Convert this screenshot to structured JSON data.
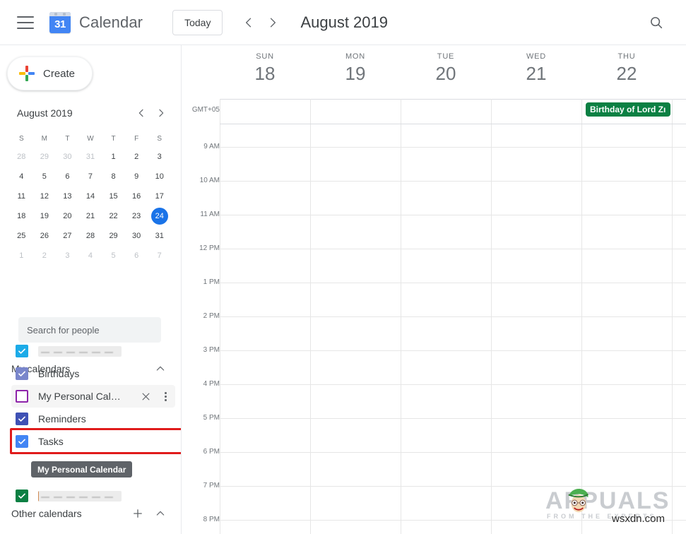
{
  "topbar": {
    "menu_icon": "hamburger-icon",
    "logo_day": "31",
    "app_title": "Calendar",
    "today_label": "Today",
    "prev_icon": "chevron-left-icon",
    "next_icon": "chevron-right-icon",
    "month_title": "August 2019",
    "search_icon": "search-icon"
  },
  "sidebar": {
    "create_label": "Create",
    "create_icon": "plus-icon",
    "mini_calendar": {
      "month_title": "August 2019",
      "prev_icon": "chevron-left-icon",
      "next_icon": "chevron-right-icon",
      "dow": [
        "S",
        "M",
        "T",
        "W",
        "T",
        "F",
        "S"
      ],
      "weeks": [
        [
          {
            "d": "28",
            "muted": true
          },
          {
            "d": "29",
            "muted": true
          },
          {
            "d": "30",
            "muted": true
          },
          {
            "d": "31",
            "muted": true
          },
          {
            "d": "1"
          },
          {
            "d": "2"
          },
          {
            "d": "3"
          }
        ],
        [
          {
            "d": "4"
          },
          {
            "d": "5"
          },
          {
            "d": "6"
          },
          {
            "d": "7"
          },
          {
            "d": "8"
          },
          {
            "d": "9"
          },
          {
            "d": "10"
          }
        ],
        [
          {
            "d": "11"
          },
          {
            "d": "12"
          },
          {
            "d": "13"
          },
          {
            "d": "14"
          },
          {
            "d": "15"
          },
          {
            "d": "16"
          },
          {
            "d": "17"
          }
        ],
        [
          {
            "d": "18"
          },
          {
            "d": "19"
          },
          {
            "d": "20"
          },
          {
            "d": "21"
          },
          {
            "d": "22"
          },
          {
            "d": "23"
          },
          {
            "d": "24",
            "today": true
          }
        ],
        [
          {
            "d": "25"
          },
          {
            "d": "26"
          },
          {
            "d": "27"
          },
          {
            "d": "28"
          },
          {
            "d": "29"
          },
          {
            "d": "30"
          },
          {
            "d": "31"
          }
        ],
        [
          {
            "d": "1",
            "muted": true
          },
          {
            "d": "2",
            "muted": true
          },
          {
            "d": "3",
            "muted": true
          },
          {
            "d": "4",
            "muted": true
          },
          {
            "d": "5",
            "muted": true
          },
          {
            "d": "6",
            "muted": true
          },
          {
            "d": "7",
            "muted": true
          }
        ]
      ]
    },
    "search_people_placeholder": "Search for people",
    "my_calendars": {
      "title": "My calendars",
      "collapse_icon": "chevron-up-icon",
      "items": [
        {
          "label": "",
          "redacted": true,
          "checked": true,
          "color": "#1cabe8"
        },
        {
          "label": "Birthdays",
          "redacted": false,
          "checked": true,
          "color": "#7986cb"
        },
        {
          "label": "My Personal Cal…",
          "redacted": false,
          "checked": false,
          "color": "#8e24aa",
          "hovered": true,
          "close_icon": "close-icon",
          "options_icon": "more-options-icon"
        },
        {
          "label": "Reminders",
          "redacted": false,
          "checked": true,
          "color": "#3f51b5"
        },
        {
          "label": "Tasks",
          "redacted": false,
          "checked": true,
          "color": "#4285f4"
        }
      ]
    },
    "other_calendars": {
      "title": "Other calendars",
      "add_icon": "plus-icon",
      "collapse_icon": "chevron-up-icon",
      "items": [
        {
          "label": "",
          "redacted": true,
          "checked": true,
          "color": "#0b8043"
        }
      ]
    },
    "tooltip_text": "My Personal Calendar"
  },
  "grid": {
    "timezone": "GMT+05",
    "days": [
      {
        "dow": "SUN",
        "num": "18"
      },
      {
        "dow": "MON",
        "num": "19"
      },
      {
        "dow": "TUE",
        "num": "20"
      },
      {
        "dow": "WED",
        "num": "21"
      },
      {
        "dow": "THU",
        "num": "22"
      }
    ],
    "hours": [
      "9 AM",
      "10 AM",
      "11 AM",
      "12 PM",
      "1 PM",
      "2 PM",
      "3 PM",
      "4 PM",
      "5 PM",
      "6 PM",
      "7 PM",
      "8 PM"
    ],
    "events": [
      {
        "title": "Birthday of Lord Zı",
        "day_index": 4,
        "allday": true,
        "color": "#0b8043"
      }
    ]
  },
  "watermark": {
    "brand": "APPUALS",
    "tagline": "FROM THE EXPERTS",
    "site": "wsxdn.com"
  }
}
